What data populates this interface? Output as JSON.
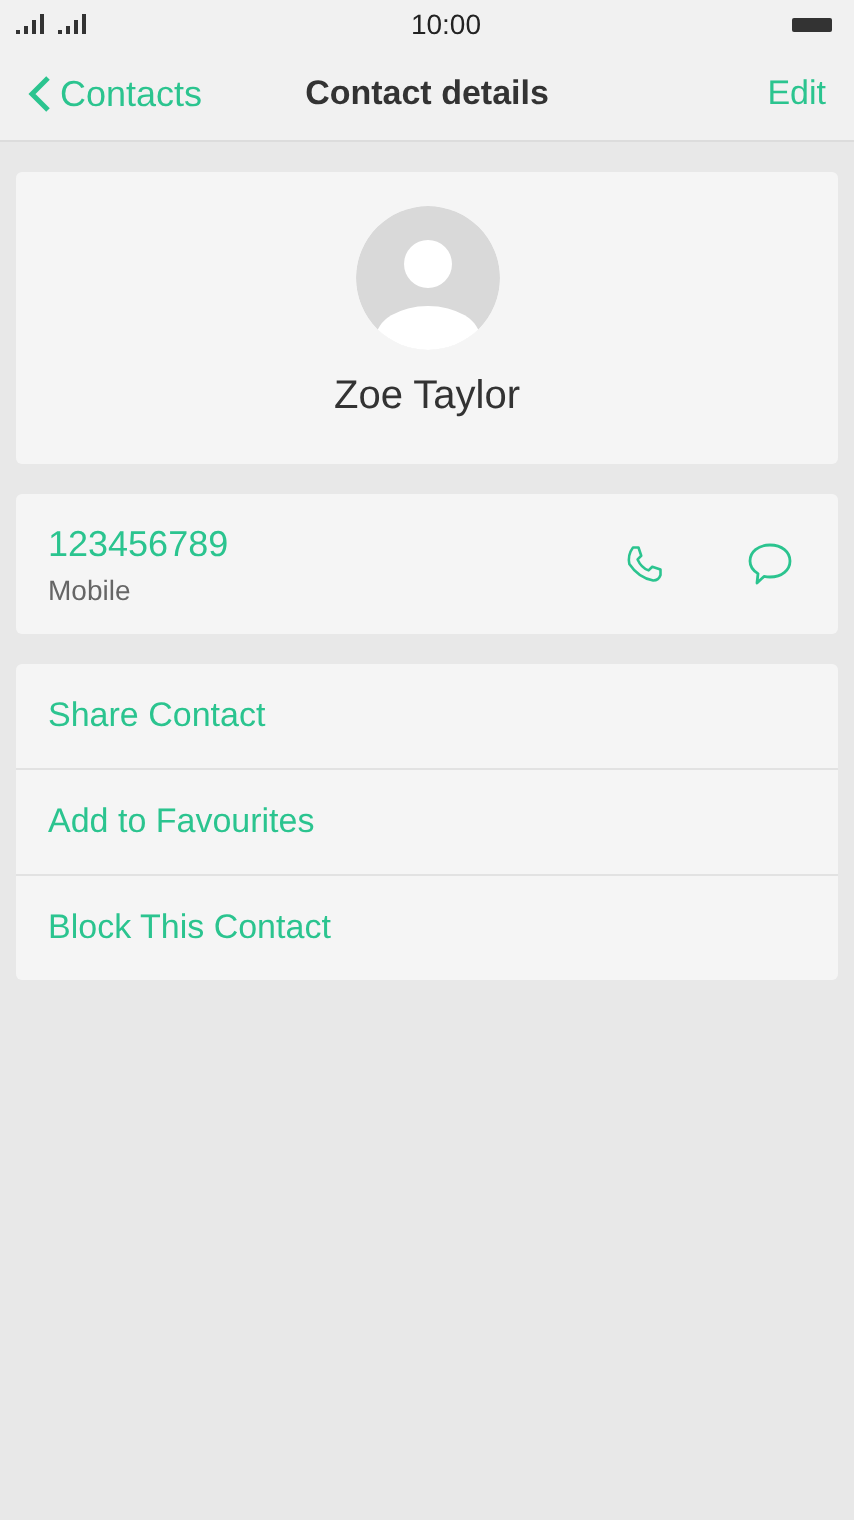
{
  "status_bar": {
    "time": "10:00"
  },
  "nav": {
    "back": "Contacts",
    "title": "Contact details",
    "action": "Edit"
  },
  "contact": {
    "name": "Zoe Taylor"
  },
  "phone": {
    "number": "123456789",
    "type": "Mobile"
  },
  "actions": [
    "Share Contact",
    "Add to Favourites",
    "Block This Contact"
  ]
}
